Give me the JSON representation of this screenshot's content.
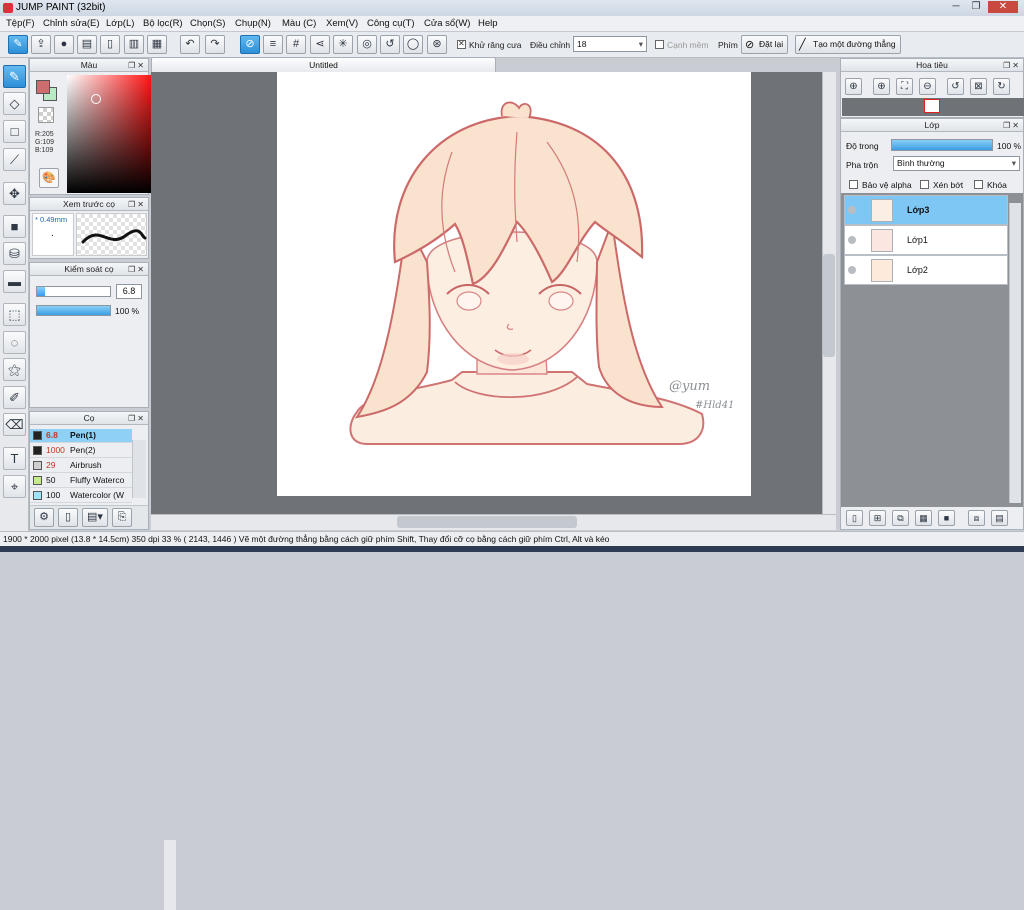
{
  "window": {
    "title": "JUMP PAINT (32bit)",
    "minimize": "─",
    "restore": "❐",
    "close": "✕"
  },
  "menu": [
    "Tệp(F)",
    "Chỉnh sửa(E)",
    "Lớp(L)",
    "Bộ lọc(R)",
    "Chọn(S)",
    "Chụp(N)",
    "Màu (C)",
    "Xem(V)",
    "Công cụ(T)",
    "Cửa sổ(W)",
    "Help"
  ],
  "toolbar": {
    "antialias_label": "Khử răng cưa",
    "adjust_label": "Điều chỉnh",
    "brush_size_value": "18",
    "smooth_label": "Cạnh mềm",
    "key_label": "Phím",
    "reset_label": "Đặt lại",
    "straight_line_label": "Tạo một đường thẳng"
  },
  "color_panel": {
    "title": "Màu",
    "rgb": "R:205\nG:109\nB:109",
    "fg_color": "#cd6d6d",
    "bg_color": "#b8ebc3"
  },
  "brush_preview_panel": {
    "title": "Xem trước cọ",
    "size": "* 0.49mm",
    "dot": "."
  },
  "brush_control_panel": {
    "title": "Kiểm soát cọ",
    "size_value": "6.8",
    "opacity_value": "100 %"
  },
  "brush_panel": {
    "title": "Cọ",
    "brushes": [
      {
        "size": "6.8",
        "name": "Pen(1)",
        "swatch": "#222222"
      },
      {
        "size": "1000",
        "name": "Pen(2)",
        "swatch": "#222222"
      },
      {
        "size": "29",
        "name": "Airbrush",
        "swatch": "#cfcfcf"
      },
      {
        "size": "50",
        "name": "Fluffy Waterco",
        "swatch": "#c6ec8a"
      },
      {
        "size": "100",
        "name": "Watercolor (W",
        "swatch": "#9ee3f7"
      }
    ]
  },
  "canvas": {
    "tab_title": "Untitled",
    "signature_text": "@yum",
    "signature_text2": "#Hld41"
  },
  "navigator_panel": {
    "title": "Hoa tiêu"
  },
  "layer_panel": {
    "title": "Lớp",
    "opacity_label": "Độ trong",
    "opacity_value": "100 %",
    "blend_label": "Pha trộn",
    "blend_value": "Bình thường",
    "protect_alpha_label": "Bảo vệ alpha",
    "clip_label": "Xén bớt",
    "lock_label": "Khóa",
    "layers": [
      {
        "name": "Lớp3",
        "selected": true
      },
      {
        "name": "Lớp1",
        "selected": false
      },
      {
        "name": "Lớp2",
        "selected": false
      }
    ]
  },
  "status": {
    "text": "1900 * 2000 pixel  (13.8 * 14.5cm)  350 dpi  33 %  ( 2143, 1446 )  Vẽ một đường thẳng bằng cách giữ phím Shift, Thay đổi cỡ cọ bằng cách giữ phím Ctrl, Alt và kéo"
  }
}
